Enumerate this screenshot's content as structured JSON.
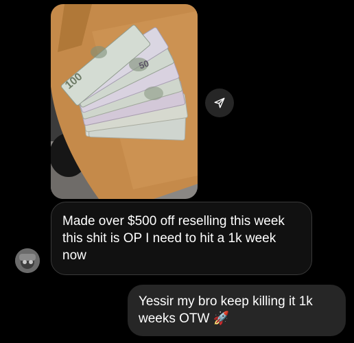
{
  "conversation": {
    "photo": {
      "banknote_denominations": [
        "100",
        "50"
      ]
    },
    "share_button": {
      "icon": "send-arrow-icon"
    },
    "received_message": {
      "text": "Made over $500 off reselling this week this shit is OP I need to hit a 1k week now"
    },
    "sent_message": {
      "text": "Yessir my bro keep killing it 1k weeks OTW",
      "emoji": "🚀"
    },
    "avatar": {
      "icon": "user-avatar"
    }
  },
  "colors": {
    "background": "#000000",
    "received_bubble": "#111111",
    "received_border": "#3a3a3a",
    "sent_bubble": "#262626",
    "text": "#ffffff"
  }
}
